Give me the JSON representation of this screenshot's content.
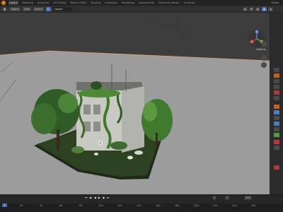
{
  "app": {
    "logo_icon": "blender-logo-icon",
    "accent": "#e87d0d"
  },
  "menu": {
    "tabs": [
      "Layout",
      "Modeling",
      "Sculpting",
      "UV Editing",
      "Texture Paint",
      "Shading",
      "Animation",
      "Rendering",
      "Compositing",
      "Geometry Nodes",
      "Scripting"
    ],
    "active_tab": "Layout",
    "scene_label": "Scene"
  },
  "viewport_header": {
    "mode": "Object",
    "search_text": "Layout",
    "view_label": "View",
    "select_label": "Select"
  },
  "overlay": {
    "options_label": "Options",
    "axes": [
      "X",
      "Y",
      "Z"
    ]
  },
  "timeline": {
    "current_frame": "1",
    "start_label": "1",
    "end_label": "250",
    "ruler_ticks": [
      "0",
      "20",
      "40",
      "60",
      "80",
      "100",
      "120",
      "140",
      "160",
      "180",
      "200",
      "220",
      "240",
      "260"
    ]
  }
}
